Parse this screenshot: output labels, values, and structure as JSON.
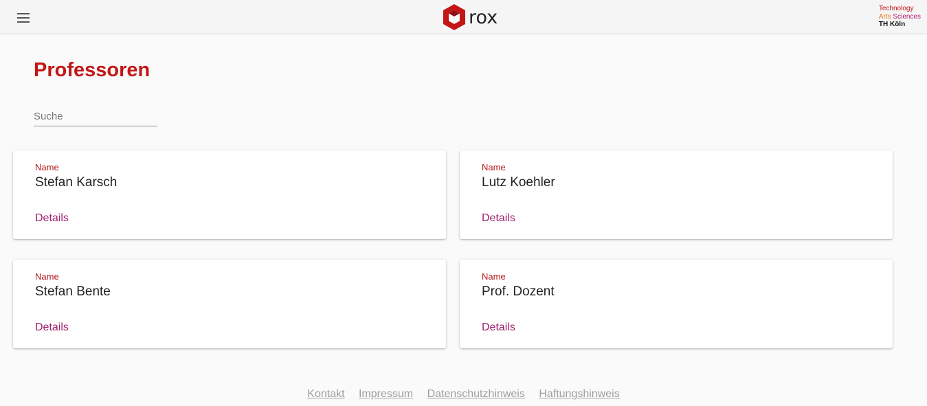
{
  "header": {
    "menu_icon": "menu-icon",
    "logo_text": "rox",
    "th_logo": {
      "line1": "Technology",
      "line2a": "Arts",
      "line2b": "Sciences",
      "line3": "TH Köln"
    },
    "colors": {
      "accent": "#c21617",
      "link": "#a0206e"
    }
  },
  "page": {
    "title": "Professoren",
    "search_placeholder": "Suche"
  },
  "cards": [
    {
      "label": "Name",
      "name": "Stefan Karsch",
      "details": "Details"
    },
    {
      "label": "Name",
      "name": "Lutz Koehler",
      "details": "Details"
    },
    {
      "label": "Name",
      "name": "Stefan Bente",
      "details": "Details"
    },
    {
      "label": "Name",
      "name": "Prof. Dozent",
      "details": "Details"
    }
  ],
  "footer": {
    "links": [
      "Kontakt",
      "Impressum",
      "Datenschutzhinweis",
      "Haftungshinweis"
    ]
  }
}
